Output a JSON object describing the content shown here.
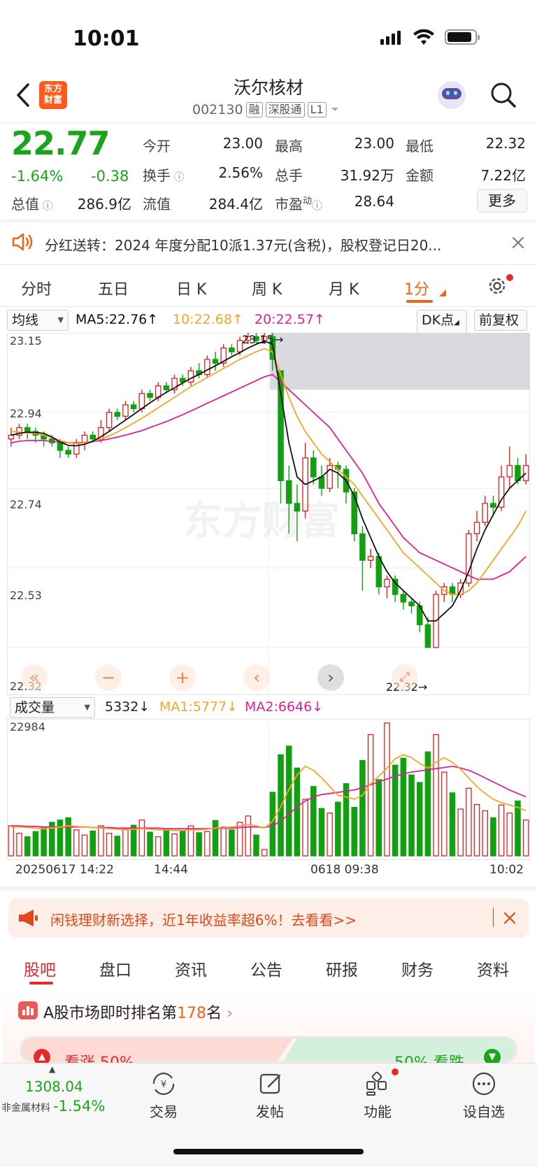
{
  "status": {
    "time": "10:01"
  },
  "header": {
    "title": "沃尔核材",
    "code": "002130",
    "tags": [
      "融",
      "深股通",
      "L1"
    ],
    "logo_text": "东方财富"
  },
  "quote": {
    "price": "22.77",
    "change_pct": "-1.64%",
    "change": "-0.38",
    "fields": {
      "open_label": "今开",
      "open": "23.00",
      "high_label": "最高",
      "high": "23.00",
      "low_label": "最低",
      "low": "22.32",
      "turnover_label": "换手",
      "turnover": "2.56%",
      "volume_label": "总手",
      "volume": "31.92万",
      "amount_label": "金额",
      "amount": "7.22亿",
      "mktcap_label": "总值",
      "mktcap": "286.9亿",
      "float_label": "流值",
      "float": "284.4亿",
      "pe_label": "市盈",
      "pe_sup": "动",
      "pe": "28.64"
    },
    "more_label": "更多"
  },
  "notice": {
    "text": "分红送转：2024 年度分配10派1.37元(含税)，股权登记日20..."
  },
  "chart_tabs": [
    "分时",
    "五日",
    "日 K",
    "周 K",
    "月 K",
    "1分"
  ],
  "chart_controls": {
    "ma_select": "均线",
    "ma5": "MA5:22.76",
    "ma10": "10:22.68",
    "ma20": "20:22.57",
    "dk_label": "DK点",
    "adjust_label": "前复权",
    "y_ticks": [
      "23.15",
      "22.94",
      "22.74",
      "22.53",
      "22.32"
    ],
    "high_annotation": "23.15",
    "low_annotation": "22.32",
    "watermark": "东方财富"
  },
  "volume_panel": {
    "select": "成交量",
    "vol": "5332",
    "ma1": "MA1:5777",
    "ma2": "MA2:6646",
    "max": "22984",
    "x_labels": [
      "20250617 14:22",
      "14:44",
      "0618 09:38",
      "10:02"
    ]
  },
  "colors": {
    "up": "#e02020",
    "down": "#10a010",
    "ma5": "#111111",
    "ma10": "#f5a623",
    "ma20": "#e0209a",
    "accent": "#f06416"
  },
  "chart_data": {
    "type": "candlestick",
    "ylim": [
      22.32,
      23.15
    ],
    "candles": [
      [
        22.87,
        22.88,
        22.85,
        22.9
      ],
      [
        22.88,
        22.9,
        22.87,
        22.91
      ],
      [
        22.9,
        22.89,
        22.87,
        22.91
      ],
      [
        22.89,
        22.88,
        22.86,
        22.9
      ],
      [
        22.88,
        22.87,
        22.85,
        22.89
      ],
      [
        22.87,
        22.86,
        22.85,
        22.88
      ],
      [
        22.86,
        22.84,
        22.82,
        22.87
      ],
      [
        22.84,
        22.83,
        22.82,
        22.85
      ],
      [
        22.83,
        22.86,
        22.82,
        22.87
      ],
      [
        22.86,
        22.88,
        22.84,
        22.89
      ],
      [
        22.88,
        22.87,
        22.86,
        22.89
      ],
      [
        22.87,
        22.9,
        22.86,
        22.92
      ],
      [
        22.9,
        22.94,
        22.89,
        22.95
      ],
      [
        22.94,
        22.93,
        22.92,
        22.95
      ],
      [
        22.93,
        22.96,
        22.92,
        22.97
      ],
      [
        22.96,
        22.95,
        22.94,
        22.97
      ],
      [
        22.95,
        22.99,
        22.94,
        23.0
      ],
      [
        22.99,
        22.98,
        22.97,
        23.0
      ],
      [
        22.98,
        23.01,
        22.97,
        23.02
      ],
      [
        23.01,
        23.0,
        22.99,
        23.02
      ],
      [
        23.0,
        23.03,
        22.99,
        23.04
      ],
      [
        23.03,
        23.02,
        23.01,
        23.04
      ],
      [
        23.02,
        23.05,
        23.01,
        23.06
      ],
      [
        23.05,
        23.04,
        23.03,
        23.07
      ],
      [
        23.04,
        23.08,
        23.03,
        23.09
      ],
      [
        23.08,
        23.07,
        23.05,
        23.1
      ],
      [
        23.07,
        23.11,
        23.06,
        23.12
      ],
      [
        23.11,
        23.1,
        23.09,
        23.12
      ],
      [
        23.1,
        23.13,
        23.09,
        23.14
      ],
      [
        23.13,
        23.14,
        23.12,
        23.15
      ],
      [
        23.14,
        23.13,
        23.12,
        23.15
      ],
      [
        23.13,
        23.14,
        23.12,
        23.15
      ],
      [
        23.14,
        23.08,
        23.05,
        23.15
      ],
      [
        23.05,
        22.76,
        22.7,
        23.05
      ],
      [
        22.76,
        22.7,
        22.62,
        22.8
      ],
      [
        22.7,
        22.68,
        22.6,
        22.75
      ],
      [
        22.68,
        22.82,
        22.66,
        22.86
      ],
      [
        22.82,
        22.77,
        22.75,
        22.84
      ],
      [
        22.77,
        22.74,
        22.72,
        22.8
      ],
      [
        22.74,
        22.8,
        22.73,
        22.82
      ],
      [
        22.8,
        22.79,
        22.74,
        22.81
      ],
      [
        22.79,
        22.73,
        22.7,
        22.8
      ],
      [
        22.73,
        22.62,
        22.6,
        22.74
      ],
      [
        22.62,
        22.55,
        22.47,
        22.64
      ],
      [
        22.55,
        22.56,
        22.53,
        22.58
      ],
      [
        22.56,
        22.48,
        22.46,
        22.57
      ],
      [
        22.48,
        22.5,
        22.45,
        22.51
      ],
      [
        22.5,
        22.46,
        22.44,
        22.51
      ],
      [
        22.46,
        22.44,
        22.42,
        22.47
      ],
      [
        22.44,
        22.43,
        22.41,
        22.45
      ],
      [
        22.43,
        22.38,
        22.36,
        22.44
      ],
      [
        22.38,
        22.32,
        22.32,
        22.4
      ],
      [
        22.32,
        22.46,
        22.32,
        22.47
      ],
      [
        22.46,
        22.48,
        22.44,
        22.49
      ],
      [
        22.48,
        22.46,
        22.44,
        22.49
      ],
      [
        22.46,
        22.49,
        22.45,
        22.5
      ],
      [
        22.49,
        22.62,
        22.48,
        22.63
      ],
      [
        22.62,
        22.65,
        22.6,
        22.68
      ],
      [
        22.65,
        22.7,
        22.64,
        22.72
      ],
      [
        22.7,
        22.69,
        22.67,
        22.72
      ],
      [
        22.69,
        22.77,
        22.68,
        22.8
      ],
      [
        22.77,
        22.8,
        22.74,
        22.85
      ],
      [
        22.8,
        22.76,
        22.75,
        22.82
      ],
      [
        22.76,
        22.8,
        22.75,
        22.83
      ]
    ],
    "ma5": [
      22.88,
      22.885,
      22.888,
      22.887,
      22.885,
      22.875,
      22.862,
      22.853,
      22.852,
      22.856,
      22.864,
      22.876,
      22.89,
      22.905,
      22.92,
      22.935,
      22.95,
      22.965,
      22.98,
      22.993,
      23.005,
      23.018,
      23.03,
      23.04,
      23.052,
      23.063,
      23.075,
      23.087,
      23.098,
      23.11,
      23.12,
      23.128,
      23.12,
      22.99,
      22.86,
      22.77,
      22.75,
      22.76,
      22.77,
      22.79,
      22.78,
      22.76,
      22.72,
      22.66,
      22.61,
      22.56,
      22.52,
      22.49,
      22.47,
      22.45,
      22.43,
      22.39,
      22.39,
      22.41,
      22.43,
      22.47,
      22.52,
      22.58,
      22.63,
      22.67,
      22.71,
      22.74,
      22.76,
      22.78
    ],
    "ma10": [
      22.89,
      22.888,
      22.886,
      22.884,
      22.88,
      22.874,
      22.866,
      22.86,
      22.858,
      22.86,
      22.864,
      22.87,
      22.878,
      22.888,
      22.9,
      22.912,
      22.924,
      22.938,
      22.952,
      22.966,
      22.98,
      22.994,
      23.008,
      23.02,
      23.032,
      23.044,
      23.056,
      23.068,
      23.08,
      23.09,
      23.1,
      23.108,
      23.1,
      23.04,
      22.98,
      22.93,
      22.89,
      22.86,
      22.83,
      22.81,
      22.79,
      22.77,
      22.75,
      22.72,
      22.69,
      22.66,
      22.63,
      22.6,
      22.57,
      22.55,
      22.53,
      22.51,
      22.49,
      22.47,
      22.46,
      22.46,
      22.47,
      22.49,
      22.52,
      22.55,
      22.58,
      22.61,
      22.64,
      22.68
    ],
    "ma20": [
      22.86,
      22.864,
      22.866,
      22.866,
      22.866,
      22.864,
      22.862,
      22.86,
      22.86,
      22.861,
      22.863,
      22.866,
      22.87,
      22.875,
      22.88,
      22.886,
      22.892,
      22.9,
      22.908,
      22.916,
      22.925,
      22.934,
      22.944,
      22.954,
      22.964,
      22.974,
      22.984,
      22.994,
      23.004,
      23.014,
      23.024,
      23.034,
      23.04,
      23.02,
      23.0,
      22.98,
      22.96,
      22.94,
      22.92,
      22.9,
      22.87,
      22.84,
      22.81,
      22.78,
      22.74,
      22.7,
      22.67,
      22.64,
      22.61,
      22.59,
      22.57,
      22.56,
      22.55,
      22.54,
      22.53,
      22.52,
      22.51,
      22.5,
      22.5,
      22.5,
      22.51,
      22.52,
      22.54,
      22.56
    ],
    "volume": [
      5200,
      3900,
      3300,
      4200,
      5000,
      5800,
      6200,
      6600,
      4500,
      3600,
      4300,
      5200,
      3900,
      3400,
      4600,
      5300,
      6200,
      4100,
      3300,
      4600,
      3800,
      4300,
      5200,
      4000,
      4200,
      6100,
      5000,
      4500,
      5800,
      6900,
      3600,
      1100,
      11000,
      17500,
      19000,
      15200,
      9800,
      12000,
      8200,
      7400,
      9300,
      12500,
      8400,
      16500,
      21000,
      13200,
      23000,
      15700,
      16900,
      14000,
      12700,
      18000,
      21000,
      14500,
      10900,
      8100,
      11700,
      8900,
      7800,
      6600,
      8800,
      7400,
      9500,
      6200
    ],
    "vol_ma1": [
      5000,
      5000,
      4900,
      4800,
      4700,
      4800,
      5000,
      5200,
      5100,
      5000,
      4900,
      4800,
      4700,
      4600,
      4500,
      4600,
      4700,
      4600,
      4500,
      4500,
      4400,
      4400,
      4500,
      4500,
      4600,
      4800,
      4900,
      5000,
      5200,
      5400,
      5200,
      4800,
      6000,
      8500,
      11500,
      14000,
      15500,
      14800,
      13500,
      12000,
      10500,
      10200,
      9800,
      10500,
      12500,
      13800,
      15200,
      16800,
      17500,
      17000,
      16000,
      15200,
      16200,
      17000,
      16200,
      15000,
      13500,
      12000,
      10800,
      9800,
      9200,
      8800,
      8400,
      7800
    ],
    "vol_ma2": [
      5200,
      5200,
      5100,
      5100,
      5000,
      5000,
      5000,
      5000,
      5000,
      5000,
      4900,
      4900,
      4900,
      4800,
      4800,
      4800,
      4800,
      4800,
      4800,
      4700,
      4700,
      4700,
      4700,
      4700,
      4700,
      4700,
      4800,
      4800,
      4900,
      5000,
      5000,
      4900,
      5200,
      6000,
      7200,
      8500,
      9500,
      10200,
      10600,
      10800,
      11000,
      11200,
      11400,
      11800,
      12300,
      12800,
      13300,
      13800,
      14200,
      14500,
      14700,
      14900,
      15100,
      15300,
      15500,
      15200,
      14800,
      14200,
      13500,
      12800,
      12100,
      11400,
      10800,
      10200
    ],
    "x_labels": [
      "20250617 14:22",
      "14:44",
      "0618 09:38",
      "10:02"
    ]
  },
  "banner": {
    "text": "闲钱理财新选择，近1年收益率超6%！去看看>>"
  },
  "bottom_tabs": [
    "股吧",
    "盘口",
    "资讯",
    "公告",
    "研报",
    "财务",
    "资料"
  ],
  "rank": {
    "prefix": "A股市场即时排名第",
    "num": "178",
    "suffix": "名"
  },
  "sentiment": {
    "up": "看涨 50%",
    "down": "50% 看跌"
  },
  "nav": {
    "index_value": "1308.04",
    "index_name": "非金属材料",
    "index_change": "-1.54%",
    "items": [
      "交易",
      "发帖",
      "功能",
      "设自选"
    ]
  }
}
